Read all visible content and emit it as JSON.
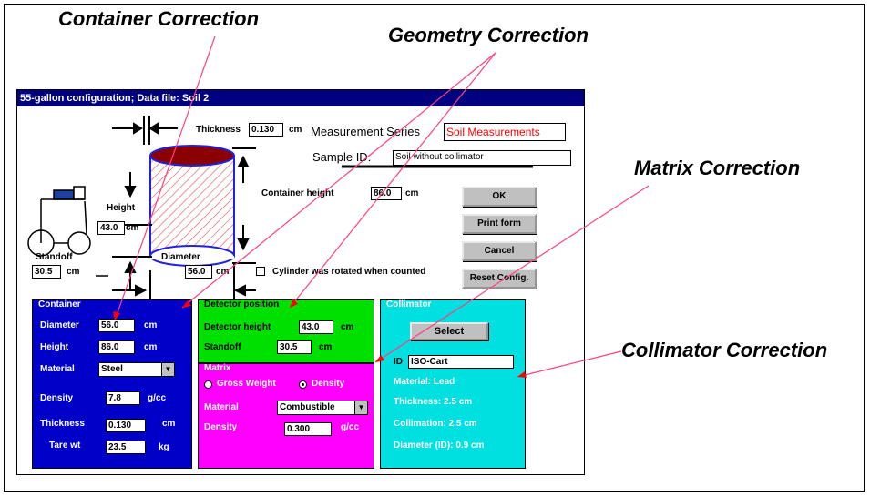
{
  "callouts": {
    "container": "Container Correction",
    "geometry": "Geometry Correction",
    "matrix": "Matrix Correction",
    "collimator": "Collimator Correction"
  },
  "dialog": {
    "title": "55-gallon configuration; Data file: Soil 2",
    "thickness_label": "Thickness",
    "thickness_value": "0.130",
    "thickness_unit": "cm",
    "series_label": "Measurement Series",
    "series_value": "Soil Measurements",
    "sample_label": "Sample ID:",
    "sample_value": "Soil without collimator",
    "container_height_label": "Container height",
    "container_height_value": "86.0",
    "container_height_unit": "cm",
    "height_label": "Height",
    "height_value": "43.0",
    "height_unit": "cm",
    "standoff_label": "Standoff",
    "standoff_value": "30.5",
    "standoff_unit": "cm",
    "diameter_label": "Diameter",
    "diameter_value": "56.0",
    "diameter_unit": "cm",
    "rotated_label": "Cylinder was rotated when counted",
    "rotated_checked": false,
    "buttons": {
      "ok": "OK",
      "print": "Print form",
      "cancel": "Cancel",
      "reset": "Reset Config."
    }
  },
  "container_panel": {
    "title": "Container",
    "color": "#0000c8",
    "diameter_label": "Diameter",
    "diameter_value": "56.0",
    "diameter_unit": "cm",
    "height_label": "Height",
    "height_value": "86.0",
    "height_unit": "cm",
    "material_label": "Material",
    "material_value": "Steel",
    "density_label": "Density",
    "density_value": "7.8",
    "density_unit": "g/cc",
    "thickness_label": "Thickness",
    "thickness_value": "0.130",
    "thickness_unit": "cm",
    "tare_label": "Tare wt",
    "tare_value": "23.5",
    "tare_unit": "kg"
  },
  "detector_panel": {
    "title": "Detector position",
    "color": "#00e000",
    "height_label": "Detector height",
    "height_value": "43.0",
    "height_unit": "cm",
    "standoff_label": "Standoff",
    "standoff_value": "30.5",
    "standoff_unit": "cm"
  },
  "matrix_panel": {
    "title": "Matrix",
    "color": "#ff00ff",
    "gross_label": "Gross Weight",
    "density_radio_label": "Density",
    "selected": "Density",
    "material_label": "Material",
    "material_value": "Combustible",
    "density_label": "Density",
    "density_value": "0.300",
    "density_unit": "g/cc"
  },
  "collimator_panel": {
    "title": "Collimator",
    "color": "#00e0e0",
    "select_label": "Select",
    "id_label": "ID",
    "id_value": "ISO-Cart",
    "material_text": "Material: Lead",
    "thickness_text": "Thickness: 2.5 cm",
    "collimation_text": "Collimation: 2.5 cm",
    "diameter_text": "Diameter (ID): 0.9 cm"
  },
  "colors": {
    "arrow_line": "#ff4080",
    "arrow_head": "#ff0000",
    "title_bar": "#000080",
    "cylinder_hatch": "#e05050",
    "cylinder_top": "#8b0000",
    "cylinder_outline": "#2020e0"
  }
}
